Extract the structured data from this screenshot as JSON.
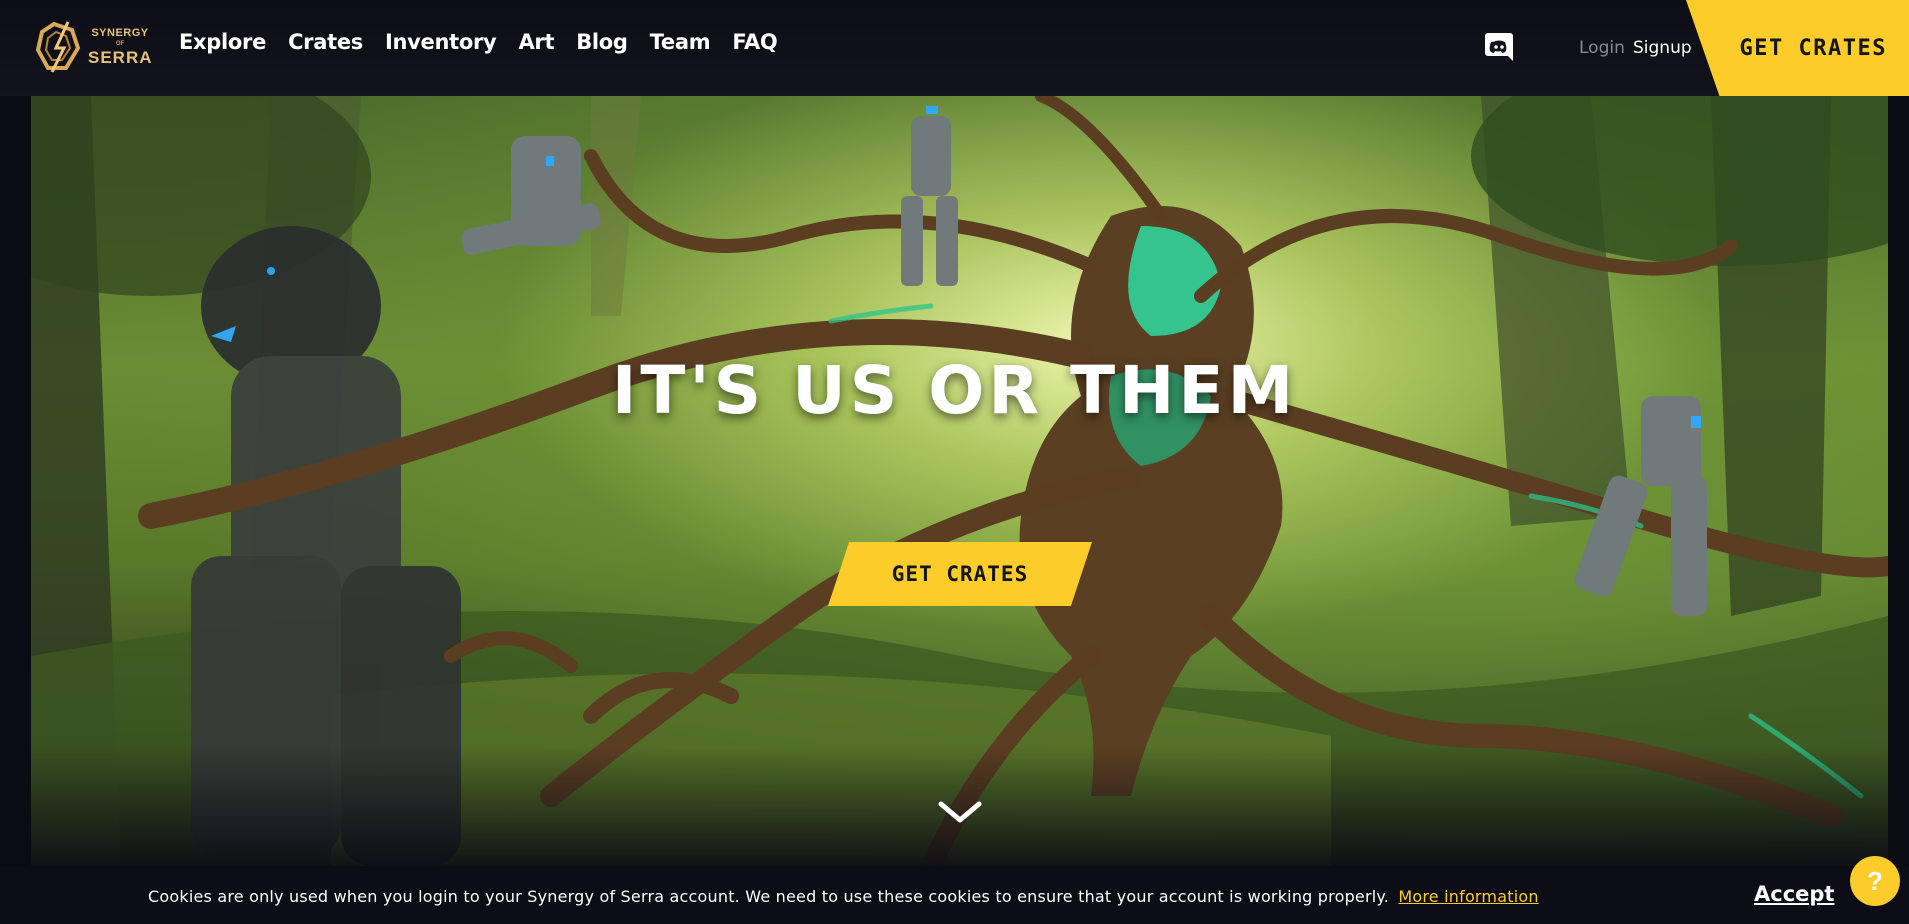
{
  "brand": {
    "logo_line1": "SYNERGY",
    "logo_line2": "OF",
    "logo_line3": "SERRA"
  },
  "nav": {
    "items": [
      {
        "label": "Explore"
      },
      {
        "label": "Crates"
      },
      {
        "label": "Inventory"
      },
      {
        "label": "Art"
      },
      {
        "label": "Blog"
      },
      {
        "label": "Team"
      },
      {
        "label": "FAQ"
      }
    ]
  },
  "header": {
    "discord_icon": "discord-icon",
    "login_label": "Login",
    "signup_label": "Signup",
    "cta_label": "GET CRATES"
  },
  "hero": {
    "headline": "IT'S US OR THEM",
    "cta_label": "GET CRATES",
    "scroll_icon": "chevron-down-icon"
  },
  "cookie": {
    "text": "Cookies are only used when you login to your Synergy of Serra account. We need to use these cookies to ensure that your account is working properly.",
    "link_label": "More information",
    "accept_label": "Accept"
  },
  "help": {
    "label": "?"
  },
  "colors": {
    "accent": "#fccc2a",
    "background": "#0b0b14"
  }
}
